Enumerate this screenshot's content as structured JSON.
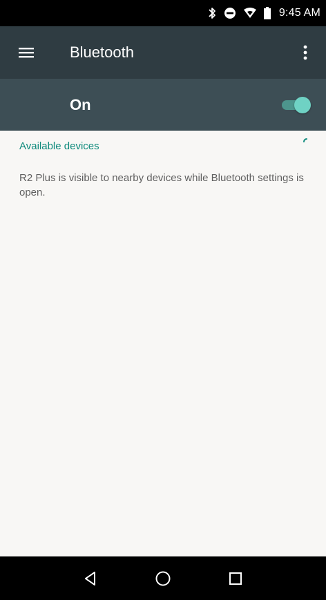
{
  "status_bar": {
    "time": "9:45 AM",
    "icons": [
      "bluetooth-icon",
      "do-not-disturb-icon",
      "wifi-icon",
      "battery-icon"
    ]
  },
  "toolbar": {
    "title": "Bluetooth",
    "menu_icon": "menu-icon",
    "more_icon": "more-vert-icon"
  },
  "master_switch": {
    "label": "On",
    "checked": true
  },
  "available_devices": {
    "header": "Available devices",
    "info_text": "R2 Plus is visible to nearby devices while Bluetooth settings is open."
  },
  "nav_bar": {
    "icons": [
      "back-icon",
      "home-icon",
      "recents-icon"
    ]
  },
  "colors": {
    "status_bar": "#000000",
    "toolbar": "#2f3c42",
    "master_bar": "#3d4e55",
    "accent": "#0e8a7c",
    "switch_thumb": "#6fd2c4",
    "background": "#f8f7f5"
  }
}
